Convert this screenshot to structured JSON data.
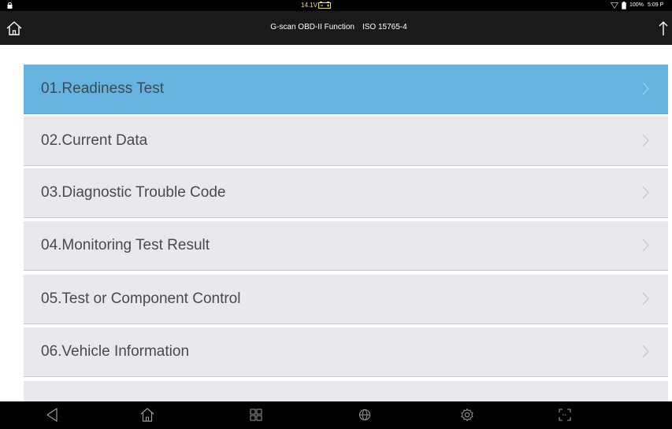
{
  "status_bar": {
    "voltage": "14.1V",
    "battery_percent": "100%",
    "time": "5:09 P",
    "icons": [
      "lock-icon",
      "car-battery-icon",
      "wifi-icon",
      "battery-icon"
    ],
    "voltage_color": "#e7e13a"
  },
  "header": {
    "title": "G-scan OBD-II Function",
    "protocol": "ISO 15765-4",
    "icons": [
      "home-icon",
      "upload-icon"
    ]
  },
  "menu": {
    "items": [
      {
        "label": "01.Readiness Test",
        "selected": true
      },
      {
        "label": "02.Current Data",
        "selected": false
      },
      {
        "label": "03.Diagnostic Trouble Code",
        "selected": false
      },
      {
        "label": "04.Monitoring Test Result",
        "selected": false
      },
      {
        "label": "05.Test or Component Control",
        "selected": false
      },
      {
        "label": "06.Vehicle Information",
        "selected": false
      }
    ],
    "selected_color": "#67b3df",
    "item_color": "#e8e8ed"
  },
  "nav_bar": {
    "icons": [
      "back-icon",
      "home-icon",
      "recent-apps-icon",
      "globe-icon",
      "settings-icon",
      "screenshot-icon"
    ]
  }
}
